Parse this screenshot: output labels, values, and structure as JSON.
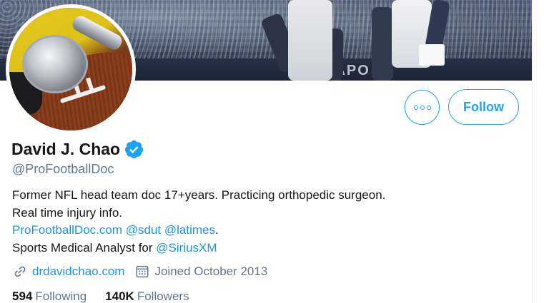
{
  "profile": {
    "name": "David J. Chao",
    "handle": "@ProFootballDoc",
    "verified": true
  },
  "banner": {
    "railing_text": "NAPO"
  },
  "bio": {
    "line1": "Former NFL head team doc 17+years. Practicing orthopedic surgeon.",
    "line2": "Real time injury info.",
    "line3_link1": "ProFootballDoc.com",
    "line3_link2": "@sdut",
    "line3_link3": "@latimes",
    "line3_suffix": ".",
    "line4_text": "Sports Medical Analyst for ",
    "line4_link": "@SiriusXM"
  },
  "meta": {
    "website": "drdavidchao.com",
    "joined": "Joined October 2013",
    "website_icon": "link-icon",
    "joined_icon": "calendar-icon"
  },
  "stats": {
    "following_count": "594",
    "following_label": "Following",
    "followers_count": "140K",
    "followers_label": "Followers"
  },
  "actions": {
    "follow_label": "Follow",
    "more_icon": "more-options-icon"
  },
  "colors": {
    "accent": "#1da1f2",
    "link": "#1b95e0",
    "secondary_text": "#657786",
    "primary_text": "#14171a"
  }
}
